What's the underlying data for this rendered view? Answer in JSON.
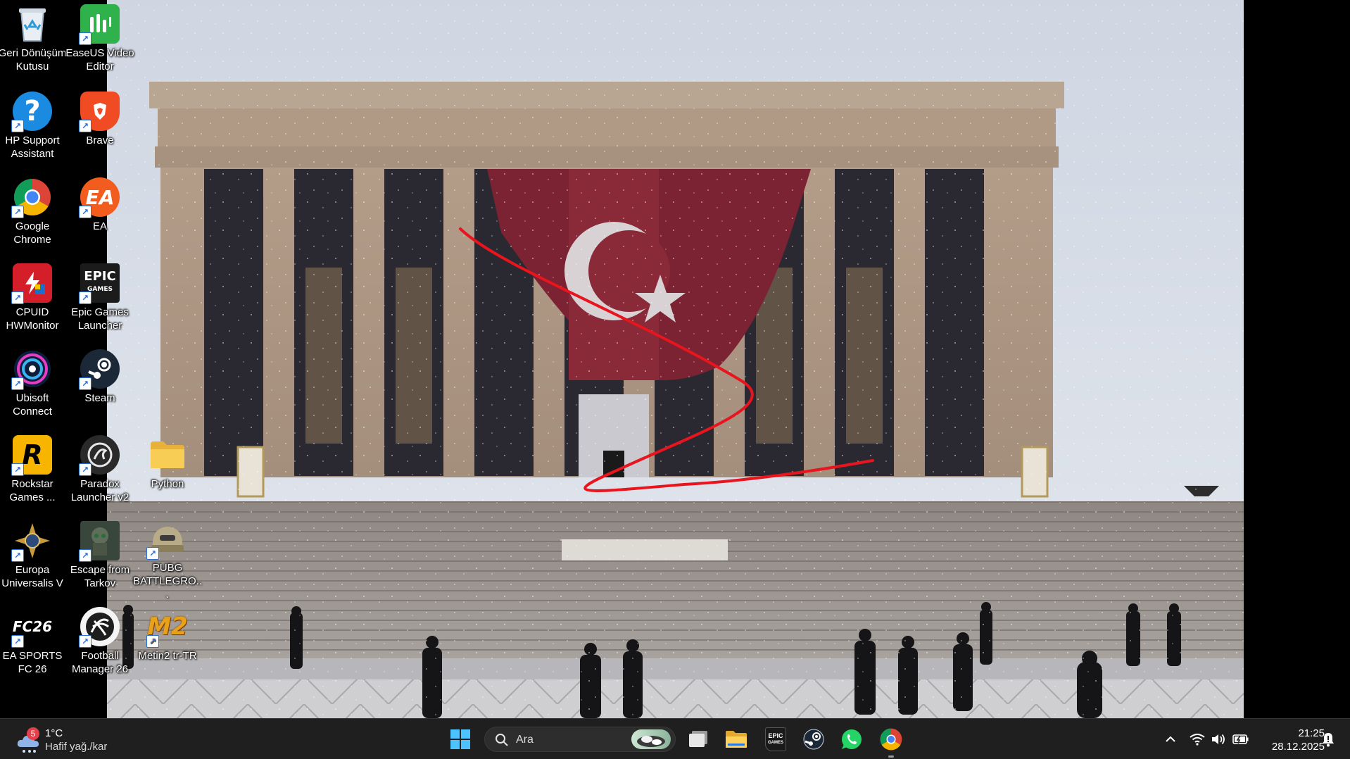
{
  "desktop_icons": [
    {
      "label": "Geri Dönüşüm Kutusu",
      "icon": "recycle-bin-icon"
    },
    {
      "label": "EaseUS Video Editor",
      "icon": "easeus-video-editor-icon"
    },
    {
      "label": "HP Support Assistant",
      "icon": "hp-support-assistant-icon"
    },
    {
      "label": "Brave",
      "icon": "brave-icon"
    },
    {
      "label": "Google Chrome",
      "icon": "google-chrome-icon"
    },
    {
      "label": "EA",
      "icon": "ea-icon"
    },
    {
      "label": "CPUID HWMonitor",
      "icon": "cpuid-hwmonitor-icon"
    },
    {
      "label": "Epic Games Launcher",
      "icon": "epic-games-icon"
    },
    {
      "label": "Ubisoft Connect",
      "icon": "ubisoft-connect-icon"
    },
    {
      "label": "Steam",
      "icon": "steam-icon"
    },
    {
      "label": "Rockstar Games ...",
      "icon": "rockstar-games-icon"
    },
    {
      "label": "Paradox Launcher v2",
      "icon": "paradox-launcher-icon"
    },
    {
      "label": "Python",
      "icon": "folder-icon"
    },
    {
      "label": "Europa Universalis V",
      "icon": "europa-universalis-icon"
    },
    {
      "label": "Escape from Tarkov",
      "icon": "escape-from-tarkov-icon"
    },
    {
      "label": "PUBG BATTLEGRO...",
      "icon": "pubg-icon"
    },
    {
      "label": "EA SPORTS FC 26",
      "icon": "ea-sports-fc-icon"
    },
    {
      "label": "Football Manager 26",
      "icon": "football-manager-icon"
    },
    {
      "label": "Metin2 tr-TR",
      "icon": "metin2-icon"
    }
  ],
  "taskbar": {
    "weather": {
      "temp": "1°C",
      "condition": "Hafif yağ./kar",
      "badge": "5"
    },
    "search": {
      "placeholder": "Ara"
    },
    "pinned": [
      "windows-start-icon",
      "task-view-icon",
      "file-explorer-icon",
      "epic-games-icon",
      "steam-icon",
      "whatsapp-icon",
      "google-chrome-icon"
    ],
    "clock": {
      "time": "21:25",
      "date": "28.12.2025"
    }
  }
}
